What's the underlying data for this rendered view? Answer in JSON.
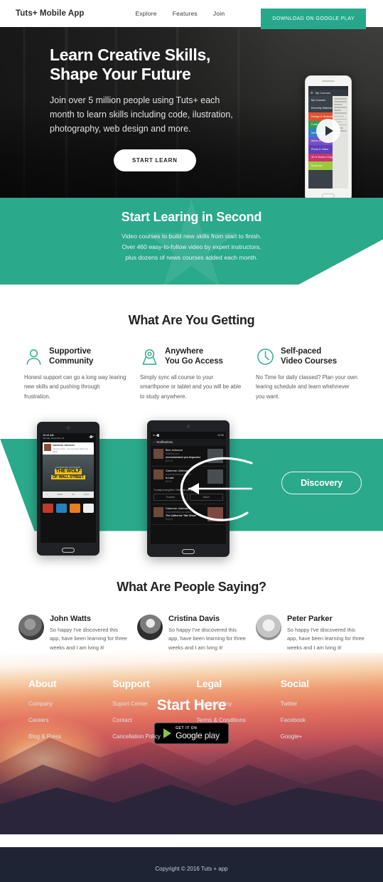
{
  "header": {
    "brand": "Tuts+ Mobile App",
    "nav": [
      {
        "label": "Explore"
      },
      {
        "label": "Features"
      },
      {
        "label": "Join"
      }
    ],
    "cta": "DOWNLOAD ON GOOGLE PLAY",
    "accent_color": "#2aa98b"
  },
  "hero": {
    "title_line1": "Learn Creative Skills,",
    "title_line2": "Shape Your Future",
    "subtitle": "Join over 5 million people using Tuts+ each month to learn skills including code, ilustration, photography, web design and more.",
    "cta": "START LEARN",
    "phone": {
      "status_title": "My Courses",
      "menu": [
        {
          "label": "My Courses",
          "color": "#3b4149"
        },
        {
          "label": "Recently Watched",
          "color": "#3b4149"
        },
        {
          "label": "Design & Illustration",
          "color": "#e0512f"
        },
        {
          "label": "Code",
          "color": "#2e9e5b"
        },
        {
          "label": "Web Design",
          "color": "#2f7fd1"
        },
        {
          "label": "Music & Audio",
          "color": "#7a4fc4"
        },
        {
          "label": "Photo & Video",
          "color": "#5d3fb8"
        },
        {
          "label": "3D & Motion Graphics",
          "color": "#c9366b"
        },
        {
          "label": "Business",
          "color": "#9cc83c"
        }
      ],
      "play_icon": "play-icon"
    }
  },
  "band": {
    "title": "Start Learing in Second",
    "line1": "Video courses to build new skills from start to finish.",
    "line2": "Over 460 easy-to-follow video by expert instructors,",
    "line3": "plus dozens of news courses added each month.",
    "watermark": "★"
  },
  "getting": {
    "title": "What Are You Getting",
    "features": [
      {
        "icon": "person-icon",
        "name_line1": "Supportive",
        "name_line2": "Community",
        "desc": "Honest support can go a long way learing new skills and pushing through frustration."
      },
      {
        "icon": "location-pin-icon",
        "name_line1": "Anywhere",
        "name_line2": "You Go Access",
        "desc": "Simply sync all course to your smarthpone or tablet and you will be able to study anywhere."
      },
      {
        "icon": "clock-icon",
        "name_line1": "Self-paced",
        "name_line2": "Video Courses",
        "desc": "No Time for daily classed? Plan your own learing schedule and learn whehnever you want."
      }
    ]
  },
  "discovery": {
    "button": "Discovery",
    "phone_left": {
      "time": "10:23 AM",
      "date": "Monday, December 15",
      "card_name": "Cameron Johnson",
      "card_time": "10:22 AM",
      "card_quote": "\"Great movie - Let me know what you think\"",
      "movie_credit": "LEONARDO DICAPRIO",
      "movie_title_1": "THE WOLF",
      "movie_title_2": "OF WALL STREET",
      "controls": [
        "i",
        "NEXT",
        "5s",
        "PLAY"
      ]
    },
    "phone_right": {
      "nav_title": "Notifications",
      "status_time": "10:30",
      "items": [
        {
          "name": "Ben Johnson",
          "action": "Watched you",
          "title": "recommended you Inspector",
          "date": "Dec 18"
        },
        {
          "name": "Cameron Johnson",
          "action": "recommended you watch",
          "title": "Is Last",
          "date": "Dec 5"
        },
        {
          "name": "Cameron Johnson",
          "action": "recommended you watch",
          "title": "The Catherine Tate Show",
          "date": "Sep 22"
        }
      ],
      "quote": "\"A really moving film. I think that was great\"",
      "buttons": [
        "Thanked",
        "Watch"
      ]
    }
  },
  "saying": {
    "title": "What Are People Saying?",
    "testimonials": [
      {
        "name": "John Watts",
        "quote": "So happy I've discovered this app, have been learning for three weeks and I am lving it!"
      },
      {
        "name": "Cristina Davis",
        "quote": "So happy I've discovered this app, have been learning for three weeks and I am lving it!"
      },
      {
        "name": "Peter Parker",
        "quote": "So happy I've discovered this app, have been learning for three weeks and I am lving it!"
      }
    ]
  },
  "start": {
    "title": "Start Here",
    "badge_small": "GET IT ON",
    "badge_big": "Google",
    "badge_big_light": " play"
  },
  "footer": {
    "columns": [
      {
        "heading": "About",
        "links": [
          {
            "label": "Company"
          },
          {
            "label": "Careers"
          },
          {
            "label": "Blog & Press"
          }
        ]
      },
      {
        "heading": "Support",
        "links": [
          {
            "label": "Suport Center"
          },
          {
            "label": "Contact"
          },
          {
            "label": "Cancellation Policy"
          }
        ]
      },
      {
        "heading": "Legal",
        "links": [
          {
            "label": "Privacy Policy"
          },
          {
            "label": "Terms & Conditions"
          }
        ]
      },
      {
        "heading": "Social",
        "links": [
          {
            "label": "Twitter"
          },
          {
            "label": "Facebook"
          },
          {
            "label": "Google+"
          }
        ]
      }
    ],
    "copyright": "Copyright © 2016 Tuts + app"
  }
}
